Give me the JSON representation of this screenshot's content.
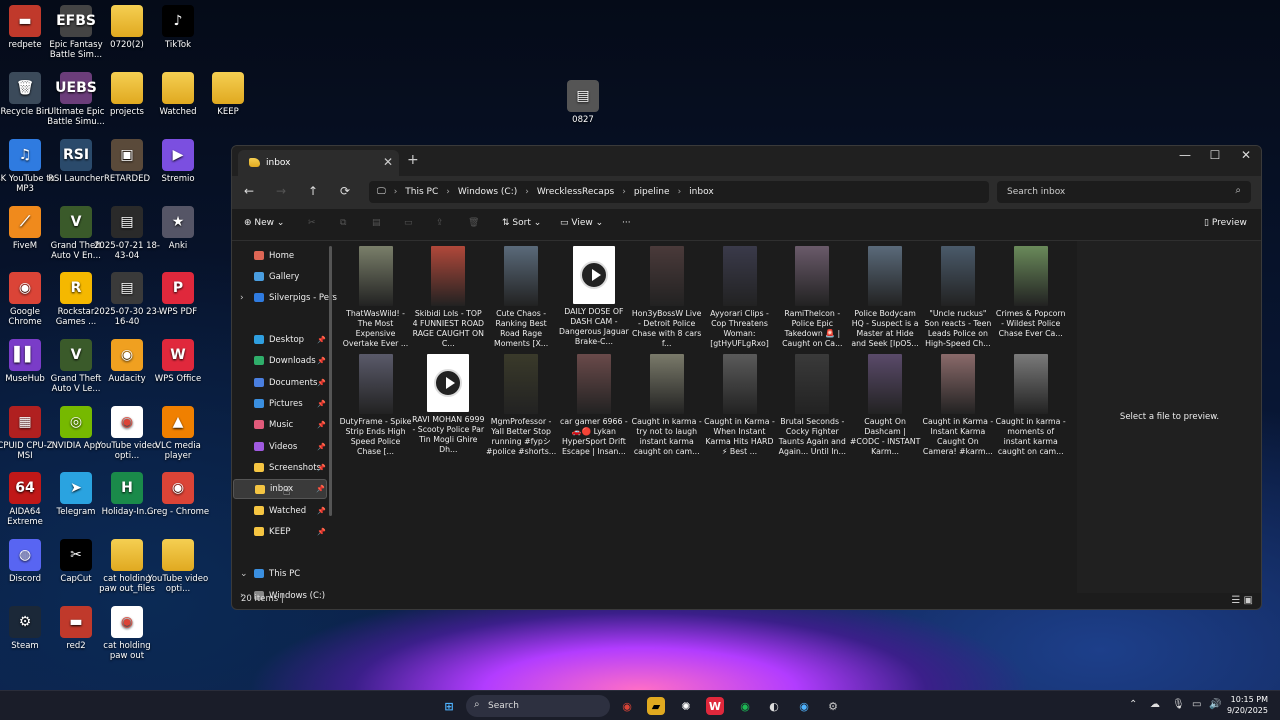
{
  "desktop": {
    "icons": [
      {
        "label": "redpete",
        "glyph": "▬",
        "color": "#c0392b"
      },
      {
        "label": "Epic Fantasy Battle Sim...",
        "glyph": "EFBS",
        "color": "#444"
      },
      {
        "label": "0720(2)",
        "glyph": "",
        "color": "folder"
      },
      {
        "label": "TikTok",
        "glyph": "♪",
        "color": "#000"
      },
      {
        "label": "Recycle Bin",
        "glyph": "🗑",
        "color": "#3b4a5a"
      },
      {
        "label": "Ultimate Epic Battle Simu...",
        "glyph": "UEBS",
        "color": "#6b3d7a"
      },
      {
        "label": "projects",
        "glyph": "",
        "color": "folder"
      },
      {
        "label": "Watched",
        "glyph": "",
        "color": "folder"
      },
      {
        "label": "KEEP",
        "glyph": "",
        "color": "folder"
      },
      {
        "label": "4K YouTube to MP3",
        "glyph": "♫",
        "color": "#2f7be0"
      },
      {
        "label": "RSI Launcher",
        "glyph": "RSI",
        "color": "#2a4a6b"
      },
      {
        "label": "RETARDED",
        "glyph": "▣",
        "color": "#5a4a3a"
      },
      {
        "label": "Stremio",
        "glyph": "▶",
        "color": "#7b4fe0"
      },
      {
        "label": "FiveM",
        "glyph": "⟋",
        "color": "#f08a1c"
      },
      {
        "label": "Grand Theft Auto V En...",
        "glyph": "V",
        "color": "#3a5a2a"
      },
      {
        "label": "2025-07-21 18-43-04",
        "glyph": "▤",
        "color": "#2a2a2a"
      },
      {
        "label": "Anki",
        "glyph": "★",
        "color": "#556"
      },
      {
        "label": "Google Chrome",
        "glyph": "◉",
        "color": "#db4437"
      },
      {
        "label": "Rockstar Games ...",
        "glyph": "R",
        "color": "#f5b800"
      },
      {
        "label": "2025-07-30 23-16-40",
        "glyph": "▤",
        "color": "#3a3a3a"
      },
      {
        "label": "WPS PDF",
        "glyph": "P",
        "color": "#e0283c"
      },
      {
        "label": "MuseHub",
        "glyph": "▌▌",
        "color": "#7a3cc8"
      },
      {
        "label": "Grand Theft Auto V Le...",
        "glyph": "V",
        "color": "#3a5a2a"
      },
      {
        "label": "Audacity",
        "glyph": "◉",
        "color": "#f0a020"
      },
      {
        "label": "WPS Office",
        "glyph": "W",
        "color": "#e0283c"
      },
      {
        "label": "CPUID CPU-Z MSI",
        "glyph": "▦",
        "color": "#b02020"
      },
      {
        "label": "NVIDIA App",
        "glyph": "◎",
        "color": "#76b900"
      },
      {
        "label": "YouTube video opti...",
        "glyph": "◉",
        "color": "#fff"
      },
      {
        "label": "VLC media player",
        "glyph": "▲",
        "color": "#f08000"
      },
      {
        "label": "AIDA64 Extreme",
        "glyph": "64",
        "color": "#c01818"
      },
      {
        "label": "Telegram",
        "glyph": "➤",
        "color": "#2aa3e0"
      },
      {
        "label": "Holiday-In...",
        "glyph": "H",
        "color": "#1a8a4a"
      },
      {
        "label": "Greg - Chrome",
        "glyph": "◉",
        "color": "#db4437"
      },
      {
        "label": "Discord",
        "glyph": "◍",
        "color": "#5865f2"
      },
      {
        "label": "CapCut",
        "glyph": "✂",
        "color": "#000"
      },
      {
        "label": "cat holding paw out_files",
        "glyph": "",
        "color": "folder"
      },
      {
        "label": "YouTube video opti...",
        "glyph": "",
        "color": "folder"
      },
      {
        "label": "Steam",
        "glyph": "⚙",
        "color": "#1b2838"
      },
      {
        "label": "red2",
        "glyph": "▬",
        "color": "#c0392b"
      },
      {
        "label": "cat holding paw out",
        "glyph": "◉",
        "color": "#fff"
      },
      {
        "label": "0827",
        "glyph": "▤",
        "color": "#555"
      }
    ]
  },
  "window": {
    "tab_title": "inbox",
    "tab_close": "✕",
    "new_tab": "+",
    "controls": {
      "minimize": "—",
      "maximize": "☐",
      "close": "✕"
    },
    "nav": {
      "back": "←",
      "forward": "→",
      "up": "↑",
      "refresh": "⟳"
    },
    "breadcrumb": [
      "This PC",
      "Windows (C:)",
      "WrecklessRecaps",
      "pipeline",
      "inbox"
    ],
    "search_placeholder": "Search inbox",
    "toolbar": {
      "new": "New",
      "sort": "Sort",
      "view": "View",
      "more": "···",
      "preview": "Preview"
    },
    "sidebar": [
      {
        "label": "Home",
        "color": "#d65"
      },
      {
        "label": "Gallery",
        "color": "#4a9ee0"
      },
      {
        "label": "Silverpigs - Pers",
        "color": "#2f7be0"
      },
      {
        "label": "Desktop",
        "color": "#2f9fe0"
      },
      {
        "label": "Downloads",
        "color": "#2fae6a"
      },
      {
        "label": "Documents",
        "color": "#4a7fe0"
      },
      {
        "label": "Pictures",
        "color": "#3a8fe0"
      },
      {
        "label": "Music",
        "color": "#e05a7a"
      },
      {
        "label": "Videos",
        "color": "#a05ae0"
      },
      {
        "label": "Screenshots",
        "color": "#f5c542"
      },
      {
        "label": "inbox",
        "color": "#f5c542"
      },
      {
        "label": "Watched",
        "color": "#f5c542"
      },
      {
        "label": "KEEP",
        "color": "#f5c542"
      },
      {
        "label": "This PC",
        "color": "#3a8fe0"
      },
      {
        "label": "Windows (C:)",
        "color": "#888"
      }
    ],
    "files": [
      {
        "name": "ThatWasWild! - The Most Expensive Overtake Ever ...",
        "kind": "thumb",
        "color": "#7a7f6a"
      },
      {
        "name": "Skibidi Lols - TOP 4 FUNNIEST ROAD RAGE CAUGHT ON C...",
        "kind": "thumb",
        "color": "#b0483a"
      },
      {
        "name": "Cute Chaos - Ranking Best Road Rage Moments [X...",
        "kind": "thumb",
        "color": "#5a6a7a"
      },
      {
        "name": "DAILY DOSE OF DASH CAM - Dangerous Jaguar Brake-C...",
        "kind": "video",
        "color": "#fff"
      },
      {
        "name": "Hon3yBossW Live - Detroit Police Chase with 8 cars f...",
        "kind": "thumb",
        "color": "#4a3a3a"
      },
      {
        "name": "Ayyorari Clips - Cop Threatens Woman: [gtHyUFLgRxo]",
        "kind": "thumb",
        "color": "#3a3a4a"
      },
      {
        "name": "RamiThelcon - Police Epic Takedown 🚨 | Caught on Ca...",
        "kind": "thumb",
        "color": "#6a5a6a"
      },
      {
        "name": "Police Bodycam HQ - Suspect is a Master at Hide and Seek [IpO5...",
        "kind": "thumb",
        "color": "#5a6a7a"
      },
      {
        "name": "\"Uncle ruckus\" Son reacts - Teen Leads Police on High-Speed Ch...",
        "kind": "thumb",
        "color": "#4a5a6a"
      },
      {
        "name": "Crimes & Popcorn - Wildest Police Chase Ever Ca...",
        "kind": "thumb",
        "color": "#6a8a5a"
      },
      {
        "name": "DutyFrame - Spike Strip Ends High Speed Police Chase [...",
        "kind": "thumb",
        "color": "#5a5a6a"
      },
      {
        "name": "RAVI MOHAN 6999 - Scooty Police Par Tin Mogli Ghire Dh...",
        "kind": "video",
        "color": "#fff"
      },
      {
        "name": "MgmProfessor - Yall Better Stop running #fypシ #police #shorts...",
        "kind": "thumb",
        "color": "#3a3a2a"
      },
      {
        "name": "car gamer 6966 - 🚗🔴 Lykan HyperSport Drift Escape | Insan...",
        "kind": "thumb",
        "color": "#6a4a4a"
      },
      {
        "name": "Caught in karma - try not to laugh instant karma caught on cam...",
        "kind": "thumb",
        "color": "#7a7a6a"
      },
      {
        "name": "Caught in Karma - When Instant Karma Hits HARD ⚡ Best ...",
        "kind": "thumb",
        "color": "#5a5a5a"
      },
      {
        "name": "Brutal Seconds - Cocky Fighter Taunts Again and Again... Until In...",
        "kind": "thumb",
        "color": "#3a3a3a"
      },
      {
        "name": "Caught On Dashcam | #CODC - INSTANT Karm...",
        "kind": "thumb",
        "color": "#5a4a6a"
      },
      {
        "name": "Caught in Karma - Instant Karma Caught On Camera! #karm...",
        "kind": "thumb",
        "color": "#8a6a6a"
      },
      {
        "name": "Caught in karma - moments of instant karma caught on cam...",
        "kind": "thumb",
        "color": "#7a7a7a"
      }
    ],
    "preview_text": "Select a file to preview.",
    "status": "20 items |"
  },
  "taskbar": {
    "search_placeholder": "Search",
    "time": "10:15 PM",
    "date": "9/20/2025"
  }
}
